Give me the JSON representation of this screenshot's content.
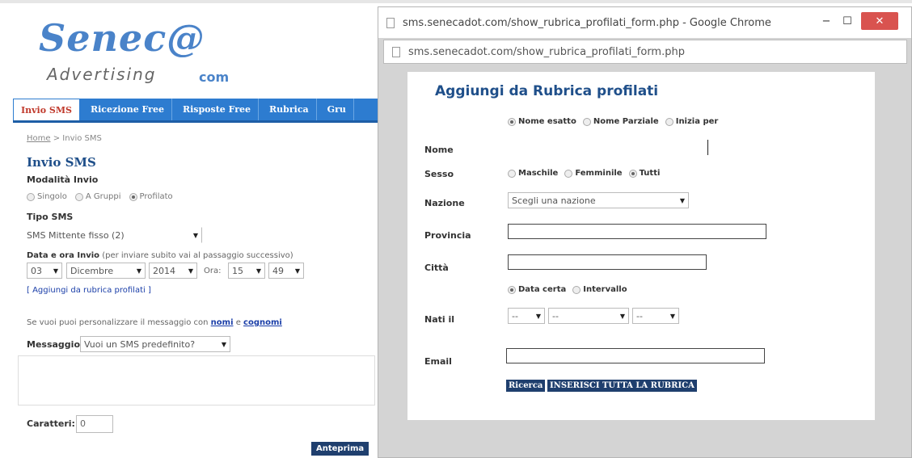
{
  "bg": {
    "logo": {
      "main": "Senec@",
      "sub": "Advertising",
      "com": "com"
    },
    "nav": [
      "Invio SMS",
      "Ricezione Free",
      "Risposte Free",
      "Rubrica",
      "Gru"
    ],
    "breadcrumb": {
      "home": "Home",
      "sep": " > ",
      "current": "Invio SMS"
    },
    "title": "Invio SMS",
    "modalita_label": "Modalità Invio",
    "modalita_options": [
      "Singolo",
      "A Gruppi",
      "Profilato"
    ],
    "tipo_label": "Tipo SMS",
    "tipo_value": "SMS Mittente fisso (2)",
    "data_label": "Data e ora Invio",
    "data_hint": "(per inviare subito vai al passaggio successivo)",
    "date": {
      "day": "03",
      "month": "Dicembre",
      "year": "2014",
      "ora_label": "Ora:",
      "hour": "15",
      "minute": "49"
    },
    "rubrica_link": "[ Aggiungi da rubrica profilati ]",
    "personalizza_text": "Se vuoi puoi personalizzare il messaggio con",
    "nomi": "nomi",
    "e": " e ",
    "cognomi": "cognomi",
    "messaggio_label": "Messaggio",
    "messaggio_value": "Vuoi un SMS predefinito?",
    "caratteri_label": "Caratteri:",
    "caratteri_value": "0",
    "anteprima": "Anteprima"
  },
  "popup": {
    "window_title": "sms.senecadot.com/show_rubrica_profilati_form.php - Google Chrome",
    "address": "sms.senecadot.com/show_rubrica_profilati_form.php",
    "title": "Aggiungi da Rubrica profilati",
    "match_options": [
      "Nome esatto",
      "Nome Parziale",
      "Inizia per"
    ],
    "nome_label": "Nome",
    "sesso_label": "Sesso",
    "sesso_options": [
      "Maschile",
      "Femminile",
      "Tutti"
    ],
    "nazione_label": "Nazione",
    "nazione_value": "Scegli una nazione",
    "provincia_label": "Provincia",
    "citta_label": "Città",
    "date_mode_options": [
      "Data certa",
      "Intervallo"
    ],
    "nati_label": "Nati il",
    "nati_day": "--",
    "nati_month": "--",
    "nati_year": "--",
    "email_label": "Email",
    "ricerca": "Ricerca",
    "inserisci": "INSERISCI TUTTA LA RUBRICA"
  }
}
